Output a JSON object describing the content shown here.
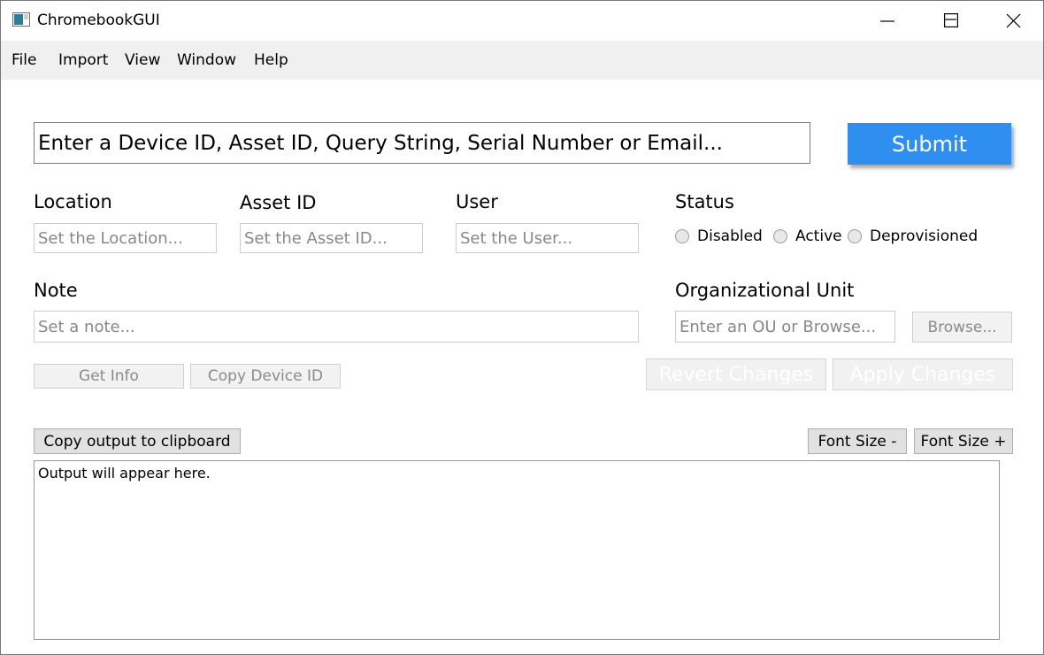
{
  "window": {
    "title": "ChromebookGUI",
    "controls": {
      "minimize": "minimize",
      "maximize": "maximize",
      "close": "close"
    }
  },
  "menu": {
    "items": [
      {
        "label": "File"
      },
      {
        "label": "Import"
      },
      {
        "label": "View"
      },
      {
        "label": "Window"
      },
      {
        "label": "Help"
      }
    ]
  },
  "search": {
    "placeholder": "Enter a Device ID, Asset ID, Query String, Serial Number or Email...",
    "value": "",
    "submit_label": "Submit"
  },
  "fields": {
    "location": {
      "label": "Location",
      "placeholder": "Set the Location..."
    },
    "asset_id": {
      "label": "Asset ID",
      "placeholder": "Set the Asset ID..."
    },
    "user": {
      "label": "User",
      "placeholder": "Set the User..."
    },
    "note": {
      "label": "Note",
      "placeholder": "Set a note..."
    },
    "org_unit": {
      "label": "Organizational Unit",
      "placeholder": "Enter an OU or Browse...",
      "browse_label": "Browse..."
    }
  },
  "status": {
    "label": "Status",
    "options": [
      {
        "label": "Disabled"
      },
      {
        "label": "Active"
      },
      {
        "label": "Deprovisioned"
      }
    ]
  },
  "actions": {
    "get_info": "Get Info",
    "copy_device_id": "Copy Device ID",
    "revert_changes": "Revert Changes",
    "apply_changes": "Apply Changes",
    "copy_output": "Copy output to clipboard",
    "font_size_minus": "Font Size -",
    "font_size_plus": "Font Size +"
  },
  "output": {
    "text": "Output will appear here."
  },
  "colors": {
    "submit": "#2f8ff0",
    "menubar": "#f0f0f0"
  }
}
